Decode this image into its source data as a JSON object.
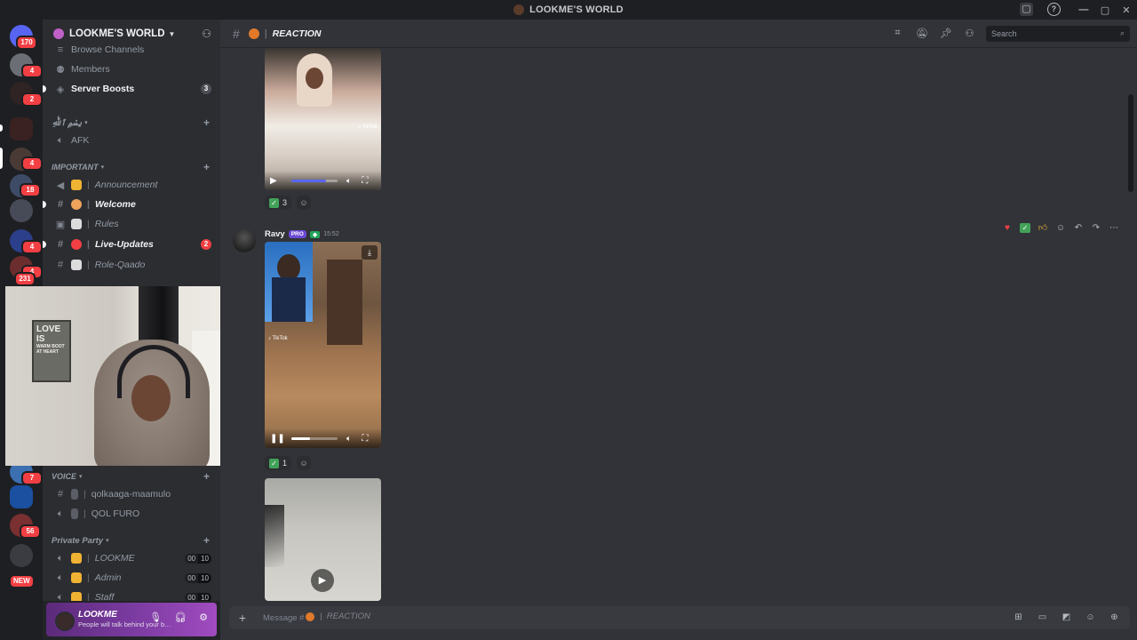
{
  "window": {
    "title": "LOOKME'S WORLD"
  },
  "server": {
    "name": "LOOKME'S WORLD"
  },
  "rail_badges": [
    "170",
    "4",
    "2",
    "4",
    "18",
    "4",
    "4",
    "231",
    "7",
    "56",
    "NEW"
  ],
  "sidebar": {
    "top_items": [
      {
        "label": "Browse Channels"
      },
      {
        "label": "Members"
      },
      {
        "label": "Server Boosts",
        "count": "3"
      }
    ],
    "cat_arabic": "بِسْمِ ٱللَّٰهِ",
    "afk": "AFK",
    "cat_important": "IMPORTANT",
    "important": [
      {
        "label": "Announcement",
        "emoji_color": "#f0b232"
      },
      {
        "label": "Welcome",
        "emoji_color": "#f0a35a"
      },
      {
        "label": "Rules",
        "emoji_color": "#dcdcdc"
      },
      {
        "label": "Live-Updates",
        "emoji_color": "#f23f43",
        "count": "2"
      },
      {
        "label": "Role-Qaado",
        "emoji_color": "#dcdcdc"
      }
    ],
    "cat_voice": "VOICE",
    "voice": [
      {
        "label": "qolkaaga-maamulo"
      },
      {
        "label": "QOL FURO"
      }
    ],
    "cat_private": "Private Party",
    "private": [
      {
        "label": "LOOKME",
        "a": "00",
        "b": "10"
      },
      {
        "label": "Admin",
        "a": "00",
        "b": "10"
      },
      {
        "label": "Staff",
        "a": "00",
        "b": "10"
      }
    ]
  },
  "user": {
    "name": "LOOKME",
    "status": "People will talk behind your ba..."
  },
  "webcam": {
    "sign_big": "LOVE IS",
    "sign_small": "WARM BOOT AT HEART"
  },
  "channel": {
    "name": "REACTION"
  },
  "search": {
    "placeholder": "Search"
  },
  "messages": {
    "first_reaction_count": "3",
    "author": {
      "name": "Ravy",
      "badge": "PRO",
      "time": "15:52"
    },
    "second_reaction_count": "1"
  },
  "composer": {
    "placeholder": "Message #",
    "channel": "REACTION"
  },
  "colors": {
    "background": "#313338",
    "sidebar": "#2b2d31",
    "accent": "#5865f2",
    "badge": "#f23f43"
  }
}
